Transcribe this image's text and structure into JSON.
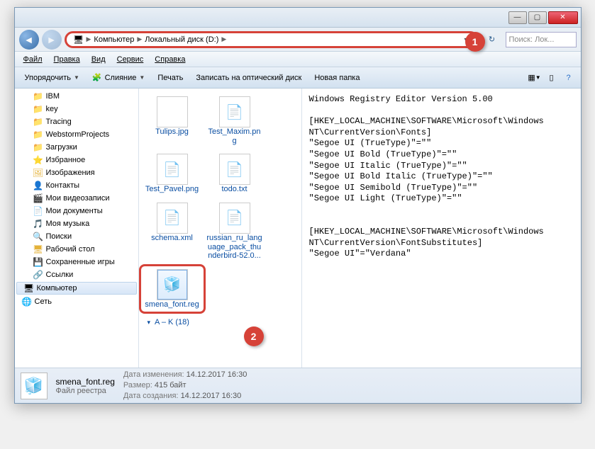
{
  "titlebar": {
    "min": "—",
    "max": "▢",
    "close": "✕"
  },
  "nav": {
    "back": "◄",
    "fwd": "►",
    "crumbs": [
      "Компьютер",
      "Локальный диск (D:)"
    ],
    "refresh": "↻",
    "search_placeholder": "Поиск: Лок...",
    "callout": "1"
  },
  "menu": [
    "Файл",
    "Правка",
    "Вид",
    "Сервис",
    "Справка"
  ],
  "toolbar": {
    "organize": "Упорядочить",
    "merge": "Слияние",
    "print": "Печать",
    "burn": "Записать на оптический диск",
    "newfolder": "Новая папка"
  },
  "sidebar": {
    "items": [
      {
        "icon": "📁",
        "label": "IBM"
      },
      {
        "icon": "📁",
        "label": "key"
      },
      {
        "icon": "📁",
        "label": "Tracing"
      },
      {
        "icon": "📁",
        "label": "WebstormProjects"
      },
      {
        "icon": "📁",
        "label": "Загрузки"
      },
      {
        "icon": "⭐",
        "label": "Избранное"
      },
      {
        "icon": "🖼",
        "label": "Изображения"
      },
      {
        "icon": "👤",
        "label": "Контакты"
      },
      {
        "icon": "🎬",
        "label": "Мои видеозаписи"
      },
      {
        "icon": "📄",
        "label": "Мои документы"
      },
      {
        "icon": "🎵",
        "label": "Моя музыка"
      },
      {
        "icon": "🔍",
        "label": "Поиски"
      },
      {
        "icon": "🖥",
        "label": "Рабочий стол"
      },
      {
        "icon": "💾",
        "label": "Сохраненные игры"
      },
      {
        "icon": "🔗",
        "label": "Ссылки"
      }
    ],
    "computer": "Компьютер",
    "network": "Сеть"
  },
  "files": [
    {
      "name": "Tulips.jpg",
      "icon": "tulips"
    },
    {
      "name": "Test_Maxim.png",
      "icon": "img"
    },
    {
      "name": "Test_Pavel.png",
      "icon": "img"
    },
    {
      "name": "todo.txt",
      "icon": "txt"
    },
    {
      "name": "schema.xml",
      "icon": "xml"
    },
    {
      "name": "russian_ru_language_pack_thunderbird-52.0...",
      "icon": "file"
    },
    {
      "name": "smena_font.reg",
      "icon": "reg",
      "selected": true
    }
  ],
  "group_header": "A – K (18)",
  "callout2": "2",
  "preview_text": "Windows Registry Editor Version 5.00\n\n[HKEY_LOCAL_MACHINE\\SOFTWARE\\Microsoft\\Windows NT\\CurrentVersion\\Fonts]\n\"Segoe UI (TrueType)\"=\"\"\n\"Segoe UI Bold (TrueType)\"=\"\"\n\"Segoe UI Italic (TrueType)\"=\"\"\n\"Segoe UI Bold Italic (TrueType)\"=\"\"\n\"Segoe UI Semibold (TrueType)\"=\"\"\n\"Segoe UI Light (TrueType)\"=\"\"\n\n\n[HKEY_LOCAL_MACHINE\\SOFTWARE\\Microsoft\\Windows NT\\CurrentVersion\\FontSubstitutes]\n\"Segoe UI\"=\"Verdana\"",
  "details": {
    "filename": "smena_font.reg",
    "filetype": "Файл реестра",
    "mod_label": "Дата изменения:",
    "mod": "14.12.2017 16:30",
    "size_label": "Размер:",
    "size": "415 байт",
    "created_label": "Дата создания:",
    "created": "14.12.2017 16:30"
  }
}
